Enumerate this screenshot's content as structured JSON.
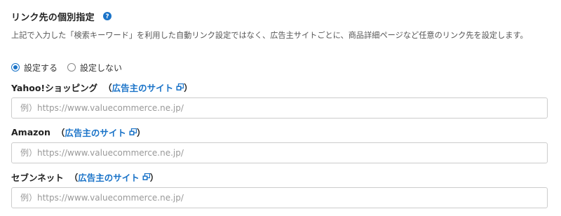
{
  "section": {
    "title": "リンク先の個別指定",
    "help_icon": "question-circle-icon",
    "description": "上記で入力した「検索キーワード」を利用した自動リンク設定ではなく、広告主サイトごとに、商品詳細ページなど任意のリンク先を設定します。"
  },
  "radio": {
    "options": [
      {
        "label": "設定する",
        "checked": true
      },
      {
        "label": "設定しない",
        "checked": false
      }
    ]
  },
  "fields": [
    {
      "name": "Yahoo!ショッピング",
      "open_paren": "（",
      "link_label": "広告主のサイト",
      "close_paren": "）",
      "link_icon": "external-link-icon",
      "placeholder": "例）https://www.valuecommerce.ne.jp/",
      "value": ""
    },
    {
      "name": "Amazon",
      "open_paren": "（",
      "link_label": "広告主のサイト",
      "close_paren": "）",
      "link_icon": "external-link-icon",
      "placeholder": "例）https://www.valuecommerce.ne.jp/",
      "value": ""
    },
    {
      "name": "セブンネット",
      "open_paren": "（",
      "link_label": "広告主のサイト",
      "close_paren": "）",
      "link_icon": "external-link-icon",
      "placeholder": "例）https://www.valuecommerce.ne.jp/",
      "value": ""
    }
  ],
  "colors": {
    "accent": "#1a73c8",
    "text": "#333333",
    "border": "#cccccc",
    "placeholder": "#999999"
  }
}
